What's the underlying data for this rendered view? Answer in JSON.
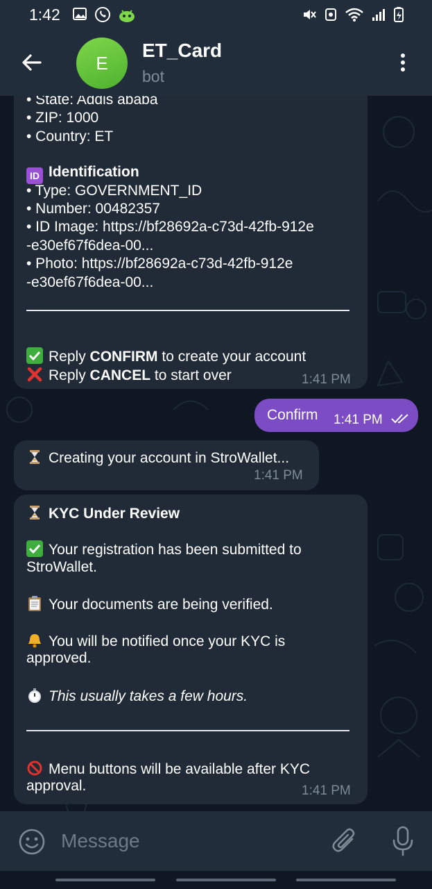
{
  "status_bar": {
    "time": "1:42",
    "left_icons": [
      "gallery-icon",
      "whatsapp-icon",
      "android-icon"
    ],
    "right_icons": [
      "mute-icon",
      "data-saver-icon",
      "wifi-icon",
      "signal-icon",
      "battery-icon"
    ]
  },
  "header": {
    "avatar_letter": "E",
    "title": "ET_Card",
    "subtitle": "bot",
    "avatar_color": "#5cbf35"
  },
  "messages": {
    "m1": {
      "state_line": "• State: Addis ababa",
      "zip_line": "• ZIP: 1000",
      "country_line": "• Country: ET",
      "id_heading": "Identification",
      "id_badge": "ID",
      "type_line": "• Type: GOVERNMENT_ID",
      "number_line": "• Number: 00482357",
      "id_image_line1": "• ID Image: https://bf28692a-c73d-42fb-912e",
      "id_image_line2": "-e30ef67f6dea-00...",
      "photo_line1": "• Photo: https://bf28692a-c73d-42fb-912e",
      "photo_line2": "-e30ef67f6dea-00...",
      "reply_confirm_pre": "Reply ",
      "reply_confirm_bold": "CONFIRM",
      "reply_confirm_post": " to create your account",
      "reply_cancel_pre": "Reply ",
      "reply_cancel_bold": "CANCEL",
      "reply_cancel_post": " to start over",
      "time": "1:41 PM"
    },
    "m2": {
      "text": "Confirm",
      "time": "1:41 PM"
    },
    "m3": {
      "text": "Creating your account in StroWallet...",
      "time": "1:41 PM"
    },
    "m4": {
      "heading": "KYC Under Review",
      "registration_line1": "Your registration has been submitted to",
      "registration_line2": "StroWallet.",
      "documents_line": "Your documents are being verified.",
      "notify_line1": "You will be notified once your KYC is",
      "notify_line2": "approved.",
      "hours_line": "This usually takes a few hours.",
      "menu_line1": "Menu buttons will be available after KYC",
      "menu_line2": "approval.",
      "time": "1:41 PM"
    }
  },
  "input_bar": {
    "placeholder": "Message"
  },
  "colors": {
    "background": "#0f1822",
    "bar": "#212d3b",
    "incoming_bubble": "#202b37",
    "outgoing_bubble": "#7c4cc4",
    "time_text": "#7e8a96"
  }
}
